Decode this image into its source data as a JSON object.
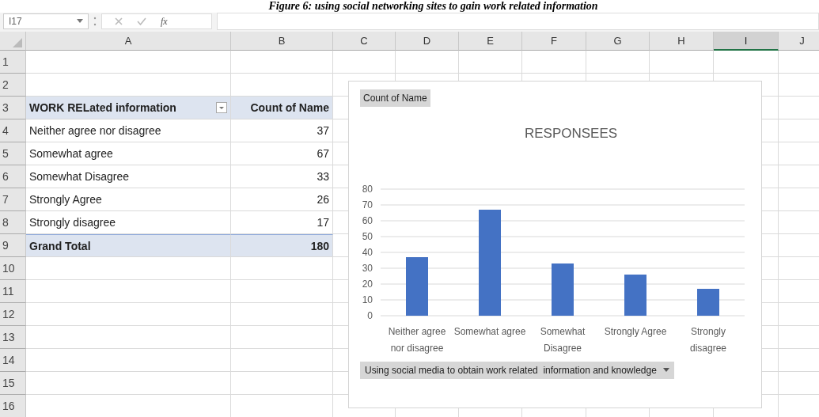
{
  "caption": "Figure 6: using social networking sites to gain work related information",
  "formula_bar": {
    "name_box": "I17",
    "fx": "fx"
  },
  "columns": [
    {
      "label": "A",
      "selected": false
    },
    {
      "label": "B",
      "selected": false
    },
    {
      "label": "C",
      "selected": false
    },
    {
      "label": "D",
      "selected": false
    },
    {
      "label": "E",
      "selected": false
    },
    {
      "label": "F",
      "selected": false
    },
    {
      "label": "G",
      "selected": false
    },
    {
      "label": "H",
      "selected": false
    },
    {
      "label": "I",
      "selected": true
    },
    {
      "label": "J",
      "selected": false
    }
  ],
  "row_numbers": [
    "1",
    "2",
    "3",
    "4",
    "5",
    "6",
    "7",
    "8",
    "9",
    "10",
    "11",
    "12",
    "13",
    "14",
    "15",
    "16"
  ],
  "pivot": {
    "header": [
      "WORK RELated information",
      "Count of Name"
    ],
    "rows": [
      [
        "Neither agree nor disagree",
        "37"
      ],
      [
        "Somewhat agree",
        "67"
      ],
      [
        "Somewhat Disagree",
        "33"
      ],
      [
        "Strongly Agree",
        "26"
      ],
      [
        "Strongly disagree",
        "17"
      ]
    ],
    "total": [
      "Grand Total",
      "180"
    ]
  },
  "chart": {
    "value_button": "Count of Name",
    "field_button": "Using social media to obtain work related  information and knowledge",
    "chart_data": {
      "type": "bar",
      "title": "RESPONSEES",
      "categories": [
        "Neither agree nor disagree",
        "Somewhat agree",
        "Somewhat Disagree",
        "Strongly Agree",
        "Strongly disagree"
      ],
      "series": [
        {
          "color": "#4472c4",
          "values": [
            37,
            67,
            33,
            26,
            17
          ]
        }
      ],
      "grid": true,
      "ylim": [
        0,
        80
      ],
      "yticks": [
        0,
        10,
        20,
        30,
        40,
        50,
        60,
        70,
        80
      ]
    }
  }
}
